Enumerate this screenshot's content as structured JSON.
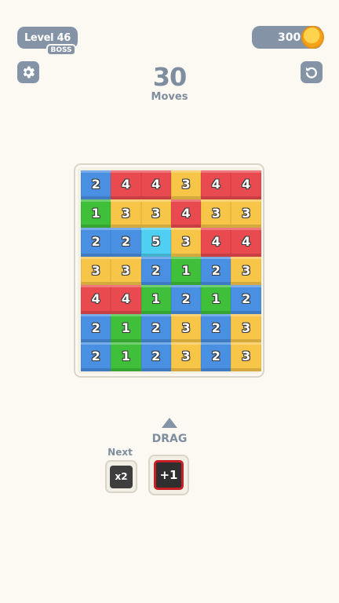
{
  "header": {
    "level_label": "Level 46",
    "boss_label": "BOSS",
    "coins": "300"
  },
  "moves": {
    "count": "30",
    "label": "Moves"
  },
  "colors": {
    "blue": "#4a90e2",
    "red": "#e84a4f",
    "yellow": "#f7c548",
    "green": "#3fbf3a",
    "cyan": "#4fd0f2"
  },
  "board": {
    "rows": [
      [
        {
          "v": "2",
          "c": "blue"
        },
        {
          "v": "4",
          "c": "red"
        },
        {
          "v": "4",
          "c": "red"
        },
        {
          "v": "3",
          "c": "yellow"
        },
        {
          "v": "4",
          "c": "red"
        },
        {
          "v": "4",
          "c": "red"
        }
      ],
      [
        {
          "v": "1",
          "c": "green"
        },
        {
          "v": "3",
          "c": "yellow"
        },
        {
          "v": "3",
          "c": "yellow"
        },
        {
          "v": "4",
          "c": "red"
        },
        {
          "v": "3",
          "c": "yellow"
        },
        {
          "v": "3",
          "c": "yellow"
        }
      ],
      [
        {
          "v": "2",
          "c": "blue"
        },
        {
          "v": "2",
          "c": "blue"
        },
        {
          "v": "5",
          "c": "cyan"
        },
        {
          "v": "3",
          "c": "yellow"
        },
        {
          "v": "4",
          "c": "red"
        },
        {
          "v": "4",
          "c": "red"
        }
      ],
      [
        {
          "v": "3",
          "c": "yellow"
        },
        {
          "v": "3",
          "c": "yellow"
        },
        {
          "v": "2",
          "c": "blue"
        },
        {
          "v": "1",
          "c": "green"
        },
        {
          "v": "2",
          "c": "blue"
        },
        {
          "v": "3",
          "c": "yellow"
        }
      ],
      [
        {
          "v": "4",
          "c": "red"
        },
        {
          "v": "4",
          "c": "red"
        },
        {
          "v": "1",
          "c": "green"
        },
        {
          "v": "2",
          "c": "blue"
        },
        {
          "v": "1",
          "c": "green"
        },
        {
          "v": "2",
          "c": "blue"
        }
      ],
      [
        {
          "v": "2",
          "c": "blue"
        },
        {
          "v": "1",
          "c": "green"
        },
        {
          "v": "2",
          "c": "blue"
        },
        {
          "v": "3",
          "c": "yellow"
        },
        {
          "v": "2",
          "c": "blue"
        },
        {
          "v": "3",
          "c": "yellow"
        }
      ],
      [
        {
          "v": "2",
          "c": "blue"
        },
        {
          "v": "1",
          "c": "green"
        },
        {
          "v": "2",
          "c": "blue"
        },
        {
          "v": "3",
          "c": "yellow"
        },
        {
          "v": "2",
          "c": "blue"
        },
        {
          "v": "3",
          "c": "yellow"
        }
      ]
    ]
  },
  "controls": {
    "drag_label": "DRAG",
    "next_label": "Next",
    "next_tile": "x2",
    "current_tile": "+1"
  },
  "icons": {
    "settings": "gear-icon",
    "undo": "undo-icon",
    "coin": "coin-icon",
    "drag": "arrow-up-icon"
  }
}
